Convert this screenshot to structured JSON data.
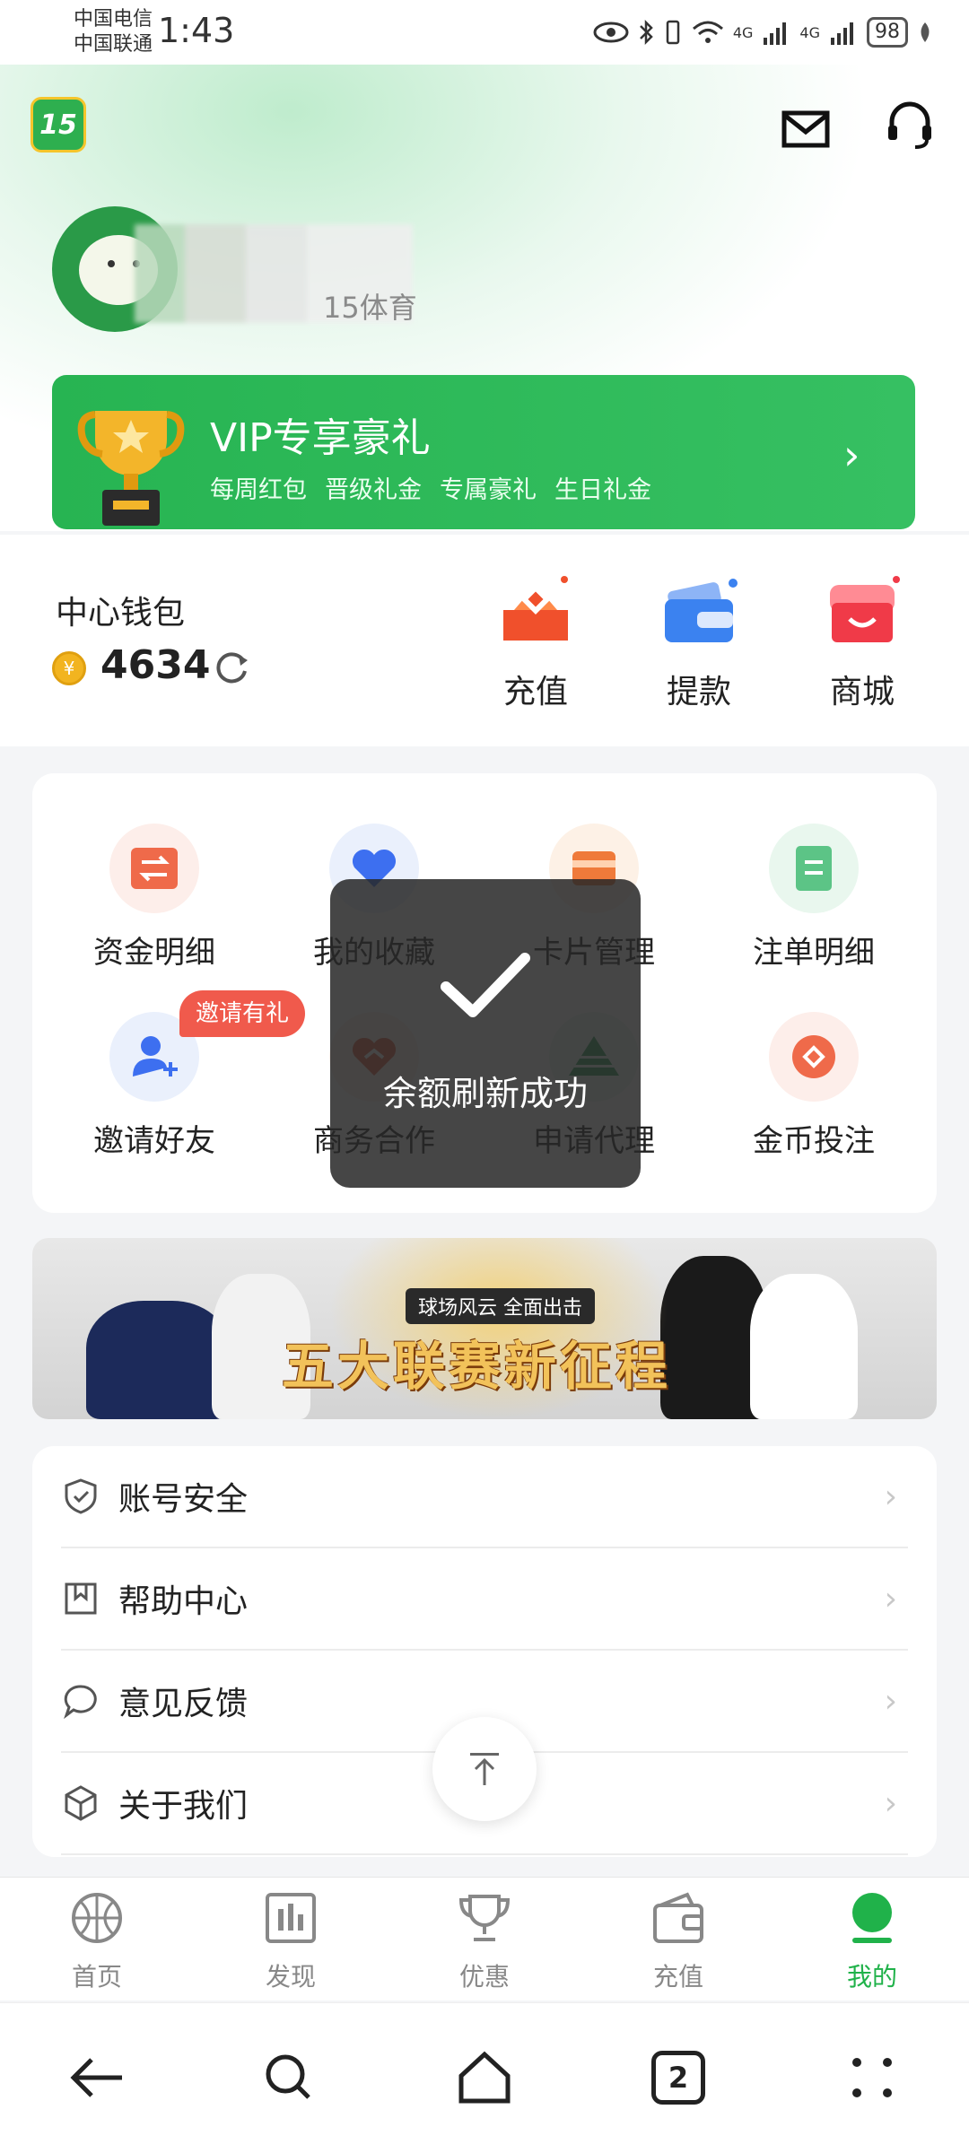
{
  "status_bar": {
    "carrier1": "中国电信",
    "carrier2": "中国联通",
    "time": "1:43",
    "network1": "4G",
    "network2": "4G",
    "battery": "98"
  },
  "header": {
    "app_logo_text": "15",
    "subtitle": "15体育"
  },
  "vip": {
    "title": "VIP专享豪礼",
    "perks": [
      "每周红包",
      "晋级礼金",
      "专属豪礼",
      "生日礼金"
    ]
  },
  "wallet": {
    "title": "中心钱包",
    "coin_symbol": "¥",
    "balance": "4634",
    "actions": [
      {
        "label": "充值",
        "icon": "deposit-icon"
      },
      {
        "label": "提款",
        "icon": "withdraw-icon"
      },
      {
        "label": "商城",
        "icon": "shop-icon"
      }
    ]
  },
  "grid": {
    "items": [
      {
        "label": "资金明细",
        "icon": "transfer-icon",
        "bg": "#fdeeea"
      },
      {
        "label": "我的收藏",
        "icon": "heart-icon",
        "bg": "#eaf0fc"
      },
      {
        "label": "卡片管理",
        "icon": "card-icon",
        "bg": "#fdf1e6"
      },
      {
        "label": "注单明细",
        "icon": "document-icon",
        "bg": "#e9f7ee"
      },
      {
        "label": "邀请好友",
        "icon": "add-user-icon",
        "bg": "#eaf0fc"
      },
      {
        "label": "商务合作",
        "icon": "handshake-icon",
        "bg": "#fdeeea"
      },
      {
        "label": "申请代理",
        "icon": "pyramid-icon",
        "bg": "#e9f7ee"
      },
      {
        "label": "金币投注",
        "icon": "coin-bet-icon",
        "bg": "#fdeeea"
      }
    ],
    "invite_badge": "邀请有礼"
  },
  "banner": {
    "tag": "球场风云 全面出击",
    "title": "五大联赛新征程"
  },
  "menu": {
    "items": [
      {
        "label": "账号安全",
        "icon": "shield-icon"
      },
      {
        "label": "帮助中心",
        "icon": "bookmark-icon"
      },
      {
        "label": "意见反馈",
        "icon": "chat-bubble-icon"
      },
      {
        "label": "关于我们",
        "icon": "cube-icon"
      }
    ]
  },
  "toast": {
    "text": "余额刷新成功"
  },
  "tabbar": {
    "tabs": [
      {
        "label": "首页",
        "icon": "basketball-icon"
      },
      {
        "label": "发现",
        "icon": "chart-board-icon"
      },
      {
        "label": "优惠",
        "icon": "trophy-icon"
      },
      {
        "label": "充值",
        "icon": "wallet-icon"
      },
      {
        "label": "我的",
        "icon": "profile-icon"
      }
    ],
    "active_index": 4
  },
  "navbar": {
    "tabs_count": "2"
  },
  "colors": {
    "brand_green": "#20b24a",
    "vip_green": "#2fb95a",
    "toast_bg": "#282828"
  }
}
